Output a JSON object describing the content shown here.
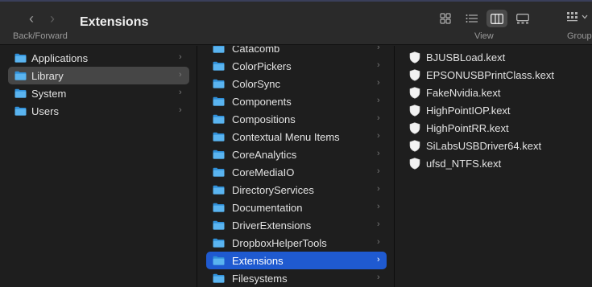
{
  "window": {
    "title": "Extensions",
    "back_forward_label": "Back/Forward",
    "view_label": "View",
    "group_label": "Group",
    "icons": [
      "chevron-left-icon",
      "chevron-right-icon",
      "grid-view-icon",
      "list-view-icon",
      "column-view-icon",
      "gallery-view-icon",
      "group-icon"
    ]
  },
  "columns": {
    "root": [
      {
        "label": "Applications"
      },
      {
        "label": "Library",
        "selected": true
      },
      {
        "label": "System"
      },
      {
        "label": "Users"
      }
    ],
    "library": [
      {
        "label": "Catacomb"
      },
      {
        "label": "ColorPickers"
      },
      {
        "label": "ColorSync"
      },
      {
        "label": "Components"
      },
      {
        "label": "Compositions"
      },
      {
        "label": "Contextual Menu Items"
      },
      {
        "label": "CoreAnalytics"
      },
      {
        "label": "CoreMediaIO"
      },
      {
        "label": "DirectoryServices"
      },
      {
        "label": "Documentation"
      },
      {
        "label": "DriverExtensions"
      },
      {
        "label": "DropboxHelperTools"
      },
      {
        "label": "Extensions",
        "selected": true
      },
      {
        "label": "Filesystems"
      }
    ],
    "extensions": [
      {
        "label": "BJUSBLoad.kext"
      },
      {
        "label": "EPSONUSBPrintClass.kext"
      },
      {
        "label": "FakeNvidia.kext"
      },
      {
        "label": "HighPointIOP.kext"
      },
      {
        "label": "HighPointRR.kext"
      },
      {
        "label": "SiLabsUSBDriver64.kext"
      },
      {
        "label": "ufsd_NTFS.kext"
      }
    ]
  },
  "colors": {
    "selection_active": "#1f5ad0",
    "selection_inactive": "#464646",
    "folder": "#4aa8e8"
  }
}
